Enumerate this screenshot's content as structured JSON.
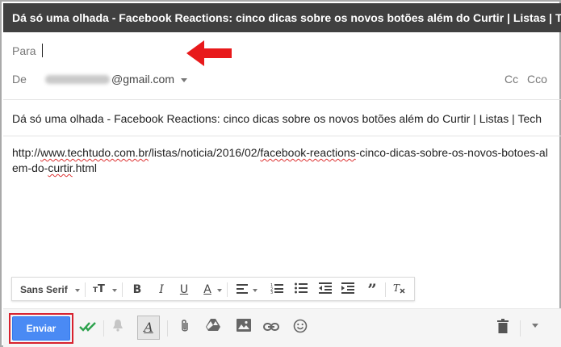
{
  "window": {
    "title": "Dá só uma olhada - Facebook Reactions: cinco dicas sobre os novos botões além do Curtir | Listas | TechTudo"
  },
  "recipients": {
    "to_label": "Para",
    "from_label": "De",
    "from_domain": "@gmail.com",
    "cc_label": "Cc",
    "bcc_label": "Cco"
  },
  "subject": "Dá só uma olhada - Facebook Reactions: cinco dicas sobre os novos botões além do Curtir | Listas | Tech",
  "message": {
    "pre": "http://",
    "link1": "www.techtudo.com.br",
    "mid1": "/listas/noticia/2016/02/",
    "link2": "facebook-reactions",
    "mid2": "-cinco-dicas-sobre-os-novos-botoes-alem-do-",
    "link3": "curtir",
    "post": ".html"
  },
  "formatting": {
    "font_label": "Sans Serif"
  },
  "toolbar": {
    "send_label": "Enviar"
  },
  "colors": {
    "accent_blue": "#4a8af4",
    "highlight_red": "#d8212e",
    "titlebar": "#404040"
  }
}
